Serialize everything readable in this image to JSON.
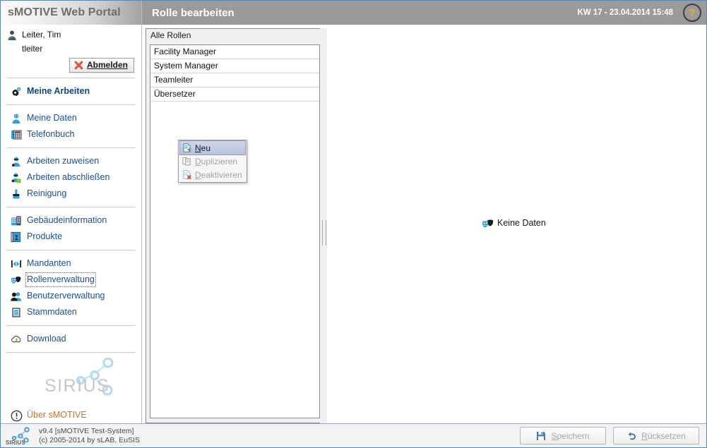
{
  "header": {
    "brand": "sMOTIVE Web Portal",
    "page_title": "Rolle bearbeiten",
    "clock": "KW 17 - 23.04.2014 15:48",
    "help_glyph": "?",
    "help_icon_name": "help-icon"
  },
  "sidebar": {
    "user": {
      "name": "Leiter, Tim",
      "login": "tleiter",
      "logout_label": "Abmelden"
    },
    "groups": [
      {
        "items": [
          {
            "label": "Meine Arbeiten",
            "icon": "gears-icon",
            "strong": true,
            "selected": false,
            "about": false
          }
        ]
      },
      {
        "items": [
          {
            "label": "Meine Daten",
            "icon": "user-data-icon",
            "strong": false,
            "selected": false,
            "about": false
          },
          {
            "label": "Telefonbuch",
            "icon": "phonebook-icon",
            "strong": false,
            "selected": false,
            "about": false
          }
        ]
      },
      {
        "items": [
          {
            "label": "Arbeiten zuweisen",
            "icon": "worker-assign-icon",
            "strong": false,
            "selected": false,
            "about": false
          },
          {
            "label": "Arbeiten abschließen",
            "icon": "worker-complete-icon",
            "strong": false,
            "selected": false,
            "about": false
          },
          {
            "label": "Reinigung",
            "icon": "cleaning-icon",
            "strong": false,
            "selected": false,
            "about": false
          }
        ]
      },
      {
        "items": [
          {
            "label": "Gebäudeinformation",
            "icon": "building-icon",
            "strong": false,
            "selected": false,
            "about": false
          },
          {
            "label": "Produkte",
            "icon": "products-icon",
            "strong": false,
            "selected": false,
            "about": false
          }
        ]
      },
      {
        "items": [
          {
            "label": "Mandanten",
            "icon": "clients-icon",
            "strong": false,
            "selected": false,
            "about": false
          },
          {
            "label": "Rollenverwaltung",
            "icon": "roles-masks-icon",
            "strong": false,
            "selected": true,
            "about": false
          },
          {
            "label": "Benutzerverwaltung",
            "icon": "users-icon",
            "strong": false,
            "selected": false,
            "about": false
          },
          {
            "label": "Stammdaten",
            "icon": "masterdata-icon",
            "strong": false,
            "selected": false,
            "about": false
          }
        ]
      },
      {
        "items": [
          {
            "label": "Download",
            "icon": "download-cloud-icon",
            "strong": false,
            "selected": false,
            "about": false
          }
        ]
      }
    ],
    "about": {
      "label": "Über sMOTIVE",
      "icon": "info-icon"
    },
    "logo_word": "SIRIUS"
  },
  "list_panel": {
    "title": "Alle Rollen",
    "rows": [
      "Facility Manager",
      "System Manager",
      "Teamleiter",
      "Übersetzer"
    ]
  },
  "context_menu": {
    "items": [
      {
        "label": "Neu",
        "accel": "N",
        "rest": "eu",
        "state": "highlighted",
        "icon": "new-document-icon"
      },
      {
        "label": "Duplizieren",
        "accel": "D",
        "rest": "uplizieren",
        "state": "disabled",
        "icon": "copy-document-icon"
      },
      {
        "label": "Deaktivieren",
        "accel": "D",
        "rest": "eaktivieren",
        "state": "disabled",
        "icon": "deactivate-document-icon"
      }
    ]
  },
  "content": {
    "empty_text": "Keine Daten",
    "empty_icon": "roles-masks-icon"
  },
  "footer": {
    "logo_word": "SIRIUS",
    "version_line": "v9.4 [sMOTIVE Test-System]",
    "copyright_line": "(c) 2005-2014 by sLAB, EuSIS",
    "buttons": [
      {
        "accel": "S",
        "rest": "peichern",
        "icon": "save-disk-icon",
        "disabled": true
      },
      {
        "accel": "R",
        "rest": "ücksetzen",
        "icon": "undo-arrow-icon",
        "disabled": true
      }
    ]
  },
  "colors": {
    "header_bg": "#9a9a9a",
    "link_blue": "#1a4f9c",
    "accent_orange": "#d2711a",
    "icon_blue": "#1f8ed6",
    "border": "#8c8c8c"
  }
}
